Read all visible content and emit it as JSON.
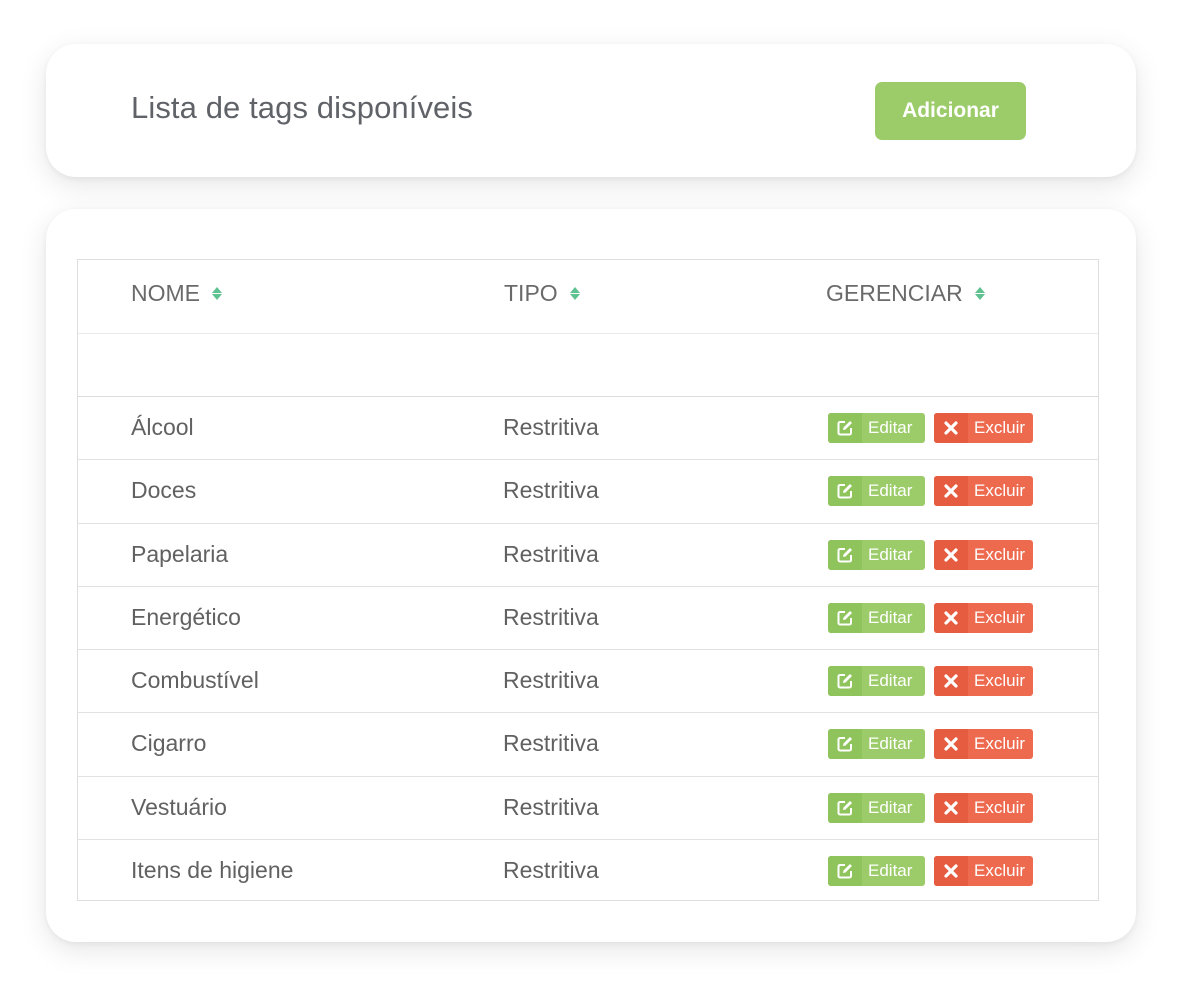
{
  "header": {
    "title": "Lista de tags disponíveis",
    "add_label": "Adicionar"
  },
  "table": {
    "columns": {
      "name": "NOME",
      "type": "TIPO",
      "manage": "GERENCIAR"
    },
    "rows": [
      {
        "name": "Álcool",
        "type": "Restritiva"
      },
      {
        "name": "Doces",
        "type": "Restritiva"
      },
      {
        "name": "Papelaria",
        "type": "Restritiva"
      },
      {
        "name": "Energético",
        "type": "Restritiva"
      },
      {
        "name": "Combustível",
        "type": "Restritiva"
      },
      {
        "name": "Cigarro",
        "type": "Restritiva"
      },
      {
        "name": "Vestuário",
        "type": "Restritiva"
      },
      {
        "name": "Itens de higiene",
        "type": "Restritiva"
      }
    ],
    "edit_label": "Editar",
    "delete_label": "Excluir"
  },
  "icons": {
    "sort": "sort-icon",
    "edit": "edit-icon",
    "delete": "close-icon"
  },
  "colors": {
    "accent_green": "#9ccc6a",
    "danger_red": "#ee6a4f",
    "sort_green": "#5fc190"
  }
}
